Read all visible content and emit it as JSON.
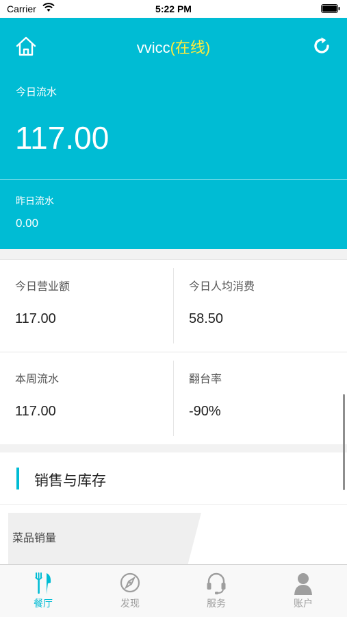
{
  "status_bar": {
    "carrier": "Carrier",
    "time": "5:22 PM"
  },
  "header": {
    "name": "vvicc",
    "status": "(在线)"
  },
  "today": {
    "label": "今日流水",
    "value": "117.00"
  },
  "yesterday": {
    "label": "昨日流水",
    "value": "0.00"
  },
  "stats": [
    {
      "label": "今日营业额",
      "value": "117.00"
    },
    {
      "label": "今日人均消费",
      "value": "58.50"
    },
    {
      "label": "本周流水",
      "value": "117.00"
    },
    {
      "label": "翻台率",
      "value": "-90%"
    }
  ],
  "section": {
    "title": "销售与库存",
    "tab_label": "菜品销量"
  },
  "tabbar": [
    {
      "label": "餐厅",
      "icon": "utensils-icon",
      "active": true
    },
    {
      "label": "发现",
      "icon": "compass-icon",
      "active": false
    },
    {
      "label": "服务",
      "icon": "headset-icon",
      "active": false
    },
    {
      "label": "账户",
      "icon": "user-icon",
      "active": false
    }
  ],
  "colors": {
    "accent": "#00BCD4",
    "online": "#FFEB3B",
    "inactive": "#9e9e9e"
  }
}
